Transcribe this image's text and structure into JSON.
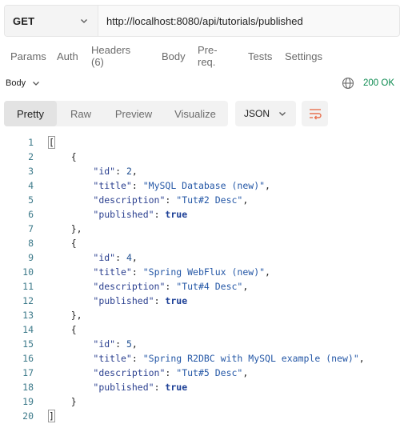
{
  "request": {
    "method": "GET",
    "url": "http://localhost:8080/api/tutorials/published"
  },
  "request_tabs": [
    {
      "label": "Params"
    },
    {
      "label": "Auth"
    },
    {
      "label": "Headers (6)"
    },
    {
      "label": "Body"
    },
    {
      "label": "Pre-req."
    },
    {
      "label": "Tests"
    },
    {
      "label": "Settings"
    }
  ],
  "response": {
    "body_label": "Body",
    "status": "200 OK",
    "view_tabs": [
      {
        "label": "Pretty",
        "active": true
      },
      {
        "label": "Raw"
      },
      {
        "label": "Preview"
      },
      {
        "label": "Visualize"
      }
    ],
    "format": "JSON"
  },
  "json_body": [
    {
      "id": 2,
      "title": "MySQL Database (new)",
      "description": "Tut#2 Desc",
      "published": true
    },
    {
      "id": 4,
      "title": "Spring WebFlux (new)",
      "description": "Tut#4 Desc",
      "published": true
    },
    {
      "id": 5,
      "title": "Spring R2DBC with MySQL example (new)",
      "description": "Tut#5 Desc",
      "published": true
    }
  ],
  "colors": {
    "status_ok": "#0b8a4f",
    "line_number": "#3d7a8a",
    "json_key": "#2a3f8f",
    "json_string": "#2457a6",
    "json_boolean": "#1c3f96",
    "wrap_icon": "#e8714f"
  },
  "icons": {
    "method_dropdown": "chevron-down-icon",
    "body_dropdown": "chevron-down-icon",
    "network": "globe-icon",
    "format_dropdown": "chevron-down-icon",
    "wrap": "wrap-lines-icon"
  }
}
